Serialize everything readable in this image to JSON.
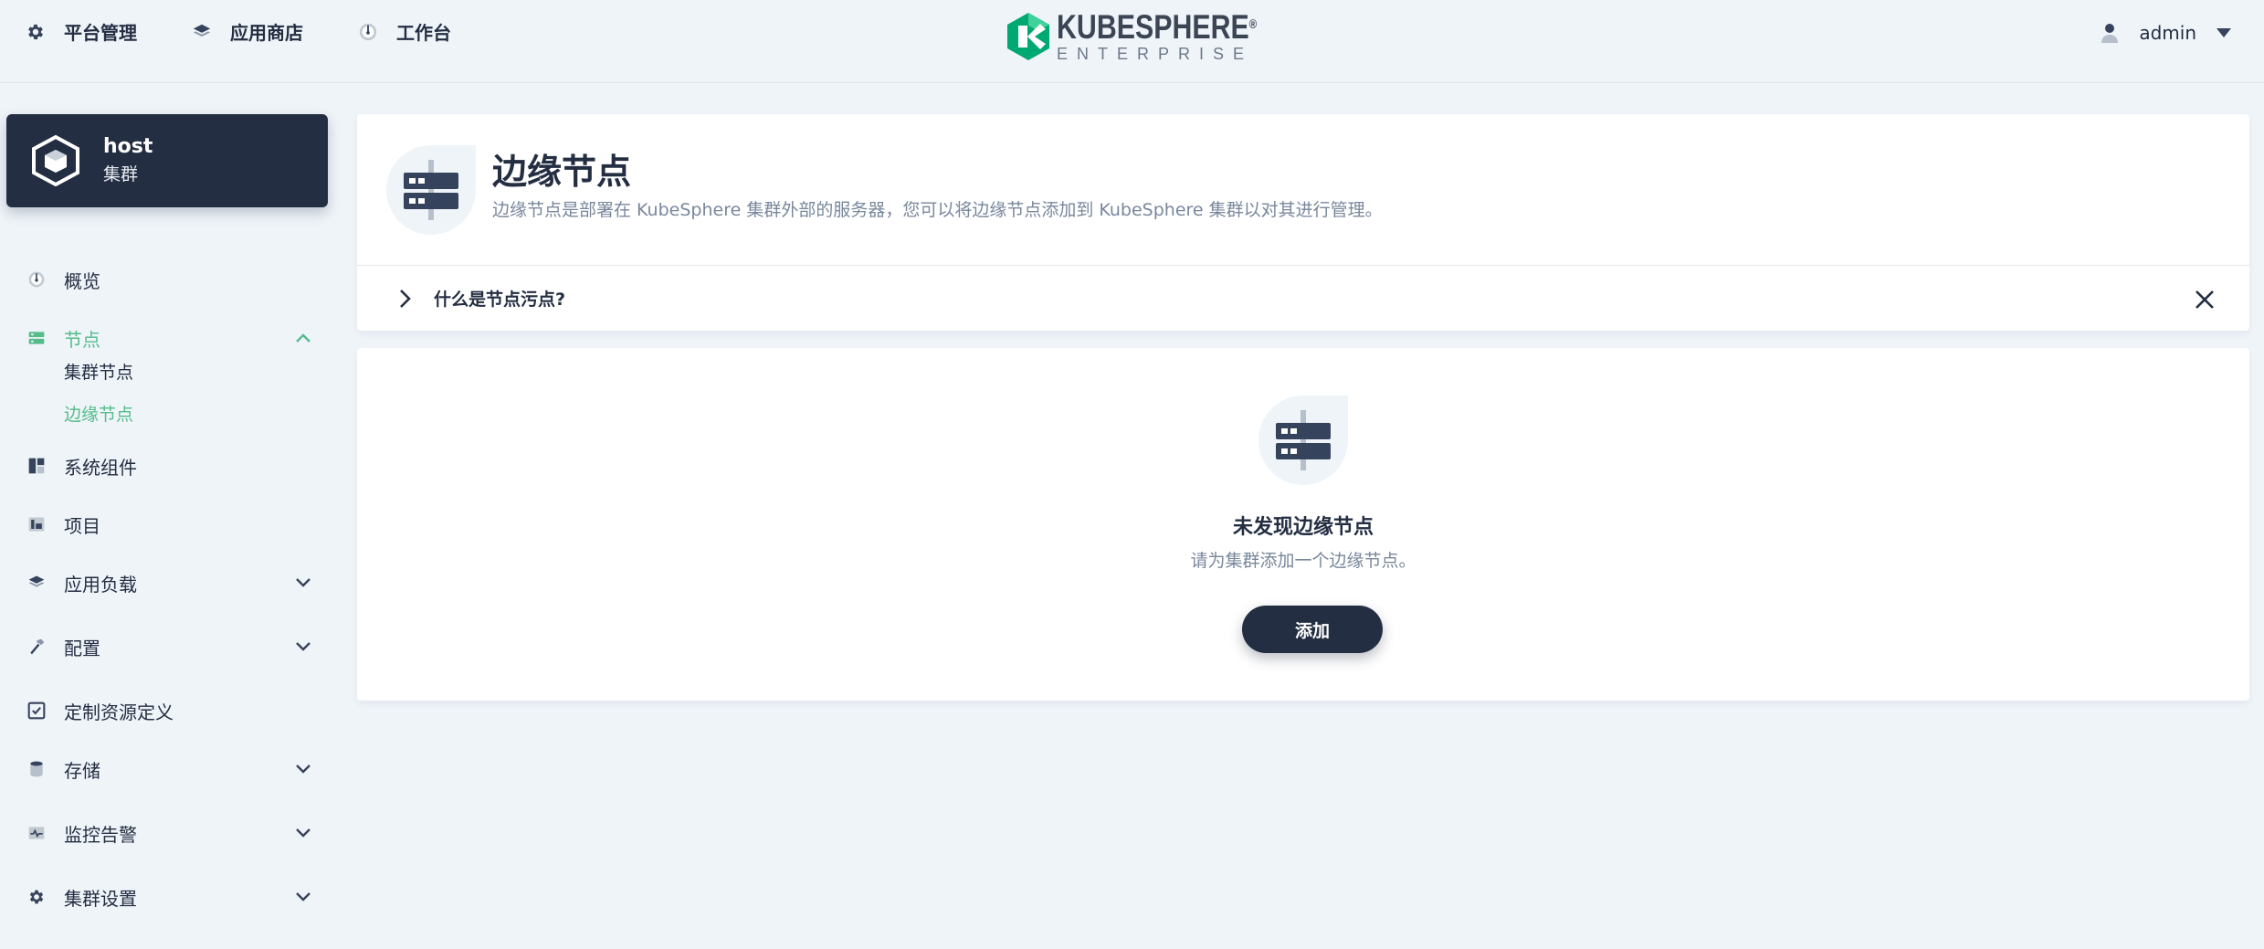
{
  "topnav": {
    "items": [
      {
        "label": "平台管理",
        "icon": "gear-icon"
      },
      {
        "label": "应用商店",
        "icon": "layers-icon"
      },
      {
        "label": "工作台",
        "icon": "dashboard-icon"
      }
    ]
  },
  "logo": {
    "main": "KUBESPHERE",
    "reg": "®",
    "sub": "ENTERPRISE"
  },
  "user": {
    "name": "admin"
  },
  "cluster": {
    "name": "host",
    "type": "集群"
  },
  "sidebar": {
    "items": [
      {
        "label": "概览",
        "icon": "dashboard-icon"
      },
      {
        "label": "节点",
        "icon": "server-icon",
        "expanded": true,
        "active": true
      },
      {
        "label": "系统组件",
        "icon": "components-icon"
      },
      {
        "label": "项目",
        "icon": "project-icon"
      },
      {
        "label": "应用负载",
        "icon": "layers-icon",
        "expandable": true
      },
      {
        "label": "配置",
        "icon": "hammer-icon",
        "expandable": true
      },
      {
        "label": "定制资源定义",
        "icon": "crd-icon"
      },
      {
        "label": "存储",
        "icon": "database-icon",
        "expandable": true
      },
      {
        "label": "监控告警",
        "icon": "monitor-icon",
        "expandable": true
      },
      {
        "label": "集群设置",
        "icon": "gear-icon",
        "expandable": true
      }
    ],
    "node_subitems": [
      {
        "label": "集群节点",
        "active": false
      },
      {
        "label": "边缘节点",
        "active": true
      }
    ]
  },
  "header": {
    "title": "边缘节点",
    "description": "边缘节点是部署在 KubeSphere 集群外部的服务器，您可以将边缘节点添加到 KubeSphere 集群以对其进行管理。",
    "tip": "什么是节点污点?"
  },
  "empty": {
    "title": "未发现边缘节点",
    "description": "请为集群添加一个边缘节点。",
    "button": "添加"
  },
  "colors": {
    "accent": "#55bc8a",
    "dark": "#242e42",
    "muted": "#79879c",
    "background": "#eff4f9"
  }
}
